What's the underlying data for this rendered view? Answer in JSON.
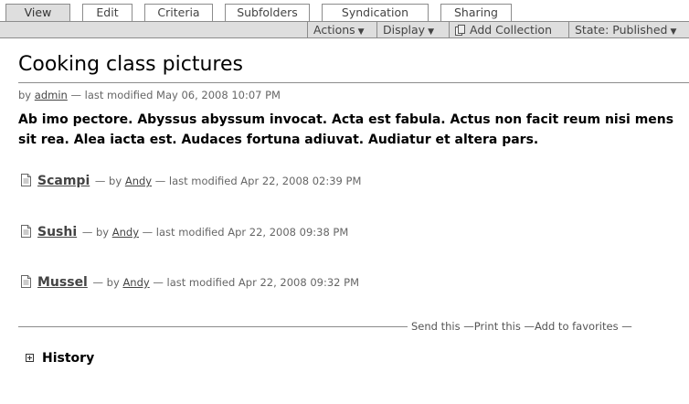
{
  "tabs": [
    {
      "label": "View",
      "active": true
    },
    {
      "label": "Edit",
      "active": false
    },
    {
      "label": "Criteria",
      "active": false
    },
    {
      "label": "Subfolders",
      "active": false
    },
    {
      "label": "Syndication",
      "active": false
    },
    {
      "label": "Sharing",
      "active": false
    }
  ],
  "actionbar": {
    "actions": "Actions",
    "display": "Display",
    "add_collection": "Add Collection",
    "state": "State: Published"
  },
  "page": {
    "title": "Cooking class pictures",
    "byline_prefix": "by",
    "author": "admin",
    "modified": "— last modified May 06, 2008 10:07 PM",
    "description": "Ab imo pectore. Abyssus abyssum invocat. Acta est fabula. Actus non facit reum nisi mens sit rea. Alea iacta est. Audaces fortuna adiuvat. Audiatur et altera pars."
  },
  "items": [
    {
      "title": "Scampi",
      "by": "— by",
      "author": "Andy",
      "modified": "— last modified Apr 22, 2008 02:39 PM"
    },
    {
      "title": "Sushi",
      "by": "— by",
      "author": "Andy",
      "modified": "— last modified Apr 22, 2008 09:38 PM"
    },
    {
      "title": "Mussel",
      "by": "— by",
      "author": "Andy",
      "modified": "— last modified Apr 22, 2008 09:32 PM"
    }
  ],
  "document_actions": {
    "send": "Send this",
    "print": "Print this",
    "favorites": "Add to favorites",
    "dash": "—"
  },
  "history": {
    "label": "History"
  },
  "icons": {
    "document": "document-icon",
    "add_collection": "add-collection-icon",
    "expand": "plus-icon",
    "dropdown": "caret-down-icon"
  }
}
